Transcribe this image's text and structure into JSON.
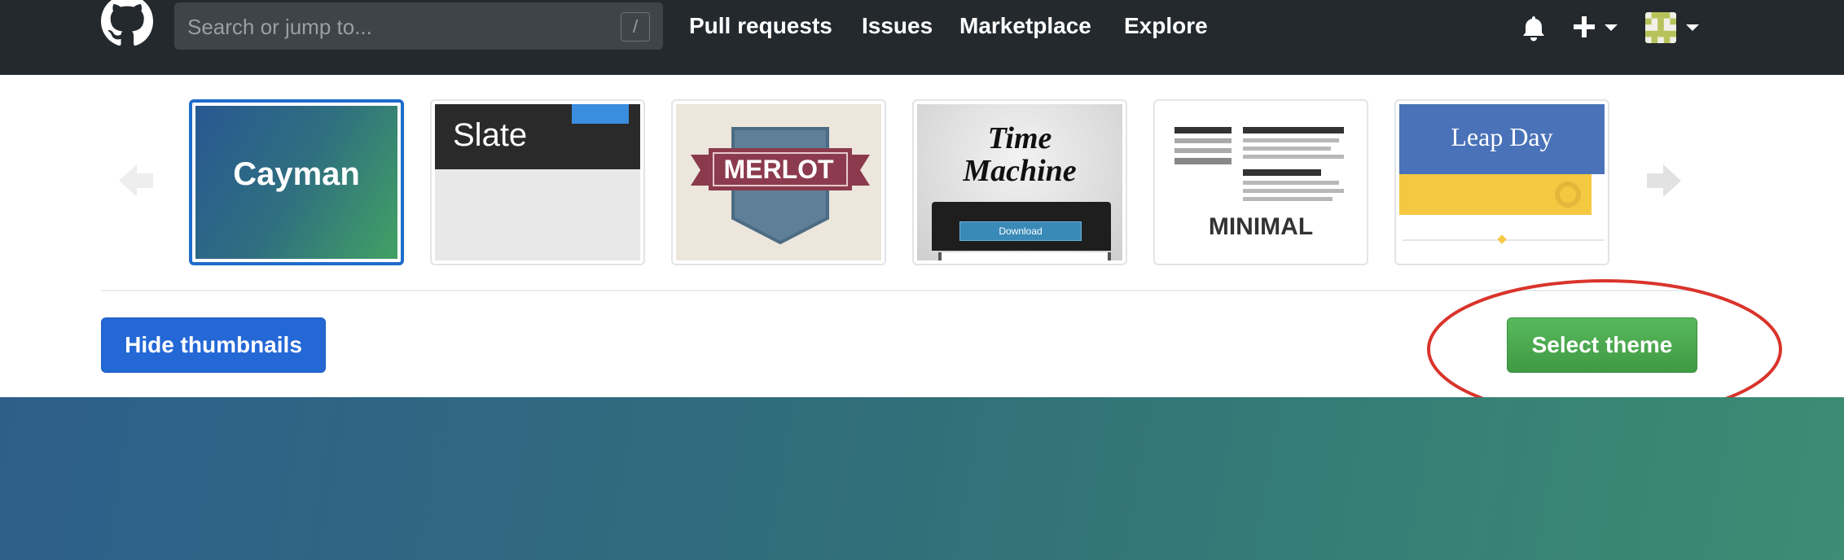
{
  "header": {
    "search_placeholder": "Search or jump to...",
    "search_shortcut": "/",
    "nav": [
      "Pull requests",
      "Issues",
      "Marketplace",
      "Explore"
    ]
  },
  "themes": [
    {
      "name": "Cayman",
      "label": "Cayman",
      "selected": true
    },
    {
      "name": "Slate",
      "label": "Slate",
      "selected": false
    },
    {
      "name": "Merlot",
      "label": "MERLOT",
      "selected": false
    },
    {
      "name": "Time Machine",
      "label_line1": "Time",
      "label_line2": "Machine",
      "download_label": "Download",
      "selected": false
    },
    {
      "name": "Minimal",
      "label": "MINIMAL",
      "selected": false
    },
    {
      "name": "Leap Day",
      "label": "Leap Day",
      "selected": false
    }
  ],
  "buttons": {
    "hide_thumbnails": "Hide thumbnails",
    "select_theme": "Select theme"
  },
  "colors": {
    "header_bg": "#24292e",
    "primary_blue": "#2468d6",
    "select_green": "#4caf50",
    "annotation_red": "#d9342b"
  }
}
